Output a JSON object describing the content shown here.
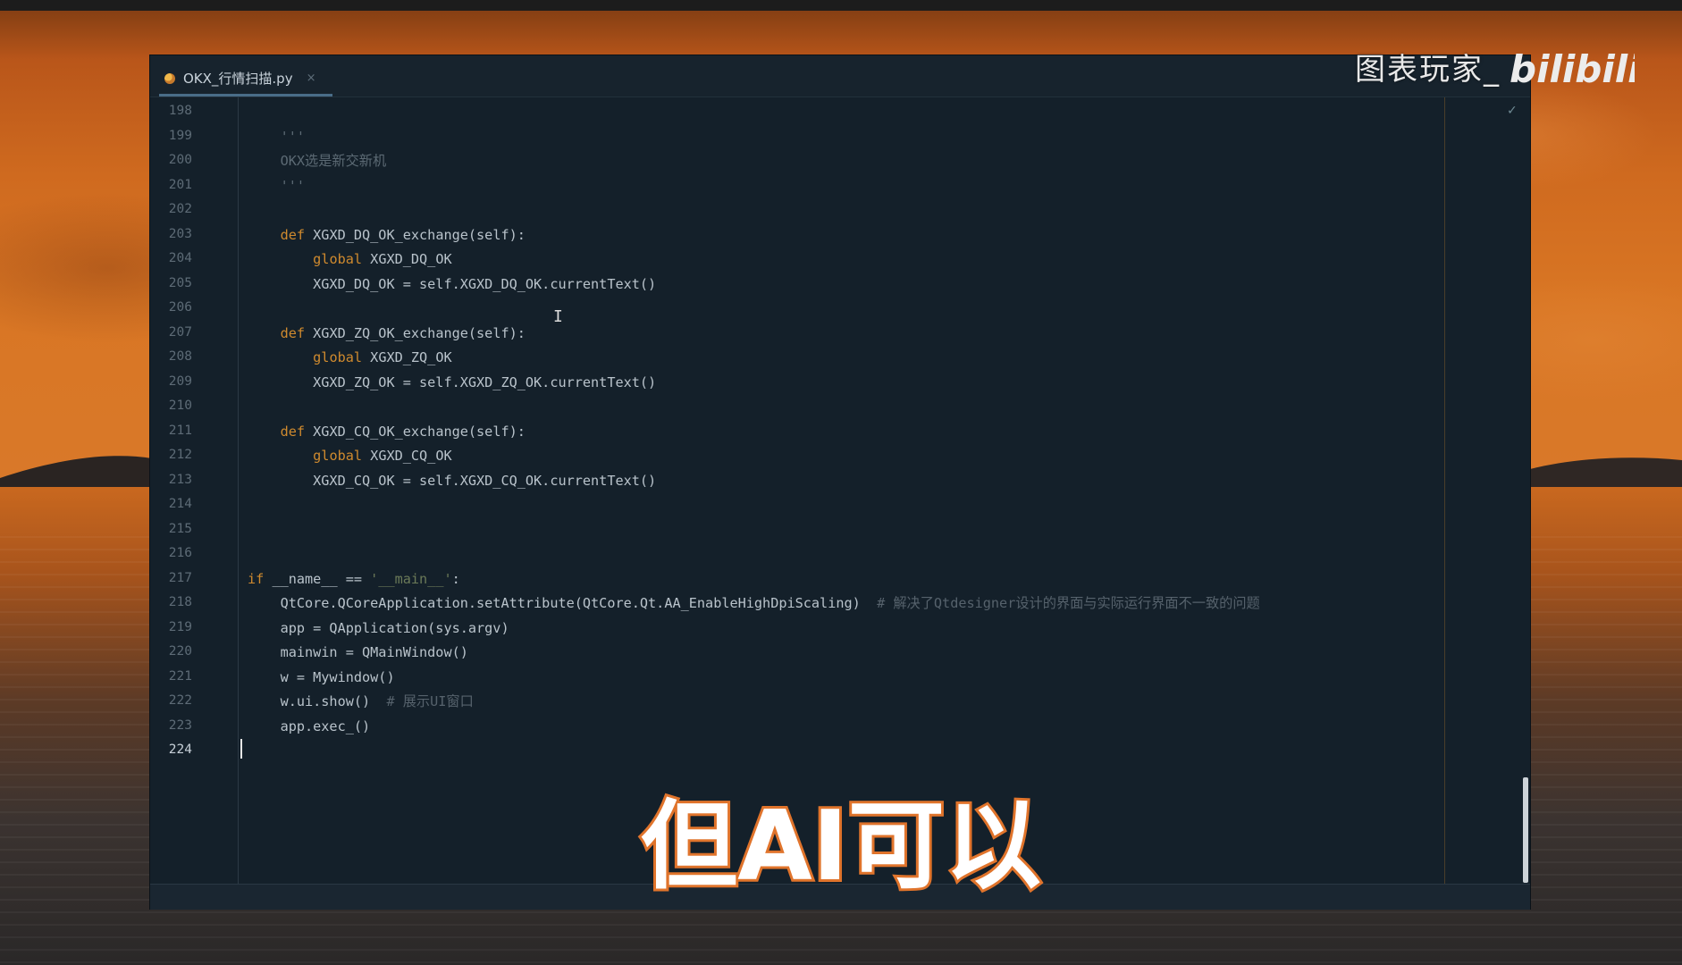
{
  "editor": {
    "tab_label": "OKX_行情扫描.py",
    "tab_close": "×",
    "current_line": "224"
  },
  "code_lines": [
    {
      "num": "198",
      "tokens": []
    },
    {
      "num": "199",
      "tokens": [
        {
          "t": "    '''",
          "c": "doc"
        }
      ]
    },
    {
      "num": "200",
      "tokens": [
        {
          "t": "    OKX选是新交新机",
          "c": "doc"
        }
      ]
    },
    {
      "num": "201",
      "tokens": [
        {
          "t": "    '''",
          "c": "doc"
        }
      ]
    },
    {
      "num": "202",
      "tokens": []
    },
    {
      "num": "203",
      "tokens": [
        {
          "t": "    ",
          "c": ""
        },
        {
          "t": "def",
          "c": "kw"
        },
        {
          "t": " XGXD_DQ_OK_exchange(self):",
          "c": ""
        }
      ]
    },
    {
      "num": "204",
      "tokens": [
        {
          "t": "        ",
          "c": ""
        },
        {
          "t": "global",
          "c": "kw"
        },
        {
          "t": " XGXD_DQ_OK",
          "c": ""
        }
      ]
    },
    {
      "num": "205",
      "tokens": [
        {
          "t": "        XGXD_DQ_OK = self.XGXD_DQ_OK.currentText()",
          "c": ""
        }
      ]
    },
    {
      "num": "206",
      "tokens": []
    },
    {
      "num": "207",
      "tokens": [
        {
          "t": "    ",
          "c": ""
        },
        {
          "t": "def",
          "c": "kw"
        },
        {
          "t": " XGXD_ZQ_OK_exchange(self):",
          "c": ""
        }
      ]
    },
    {
      "num": "208",
      "tokens": [
        {
          "t": "        ",
          "c": ""
        },
        {
          "t": "global",
          "c": "kw"
        },
        {
          "t": " XGXD_ZQ_OK",
          "c": ""
        }
      ]
    },
    {
      "num": "209",
      "tokens": [
        {
          "t": "        XGXD_ZQ_OK = self.XGXD_ZQ_OK.currentText()",
          "c": ""
        }
      ]
    },
    {
      "num": "210",
      "tokens": []
    },
    {
      "num": "211",
      "tokens": [
        {
          "t": "    ",
          "c": ""
        },
        {
          "t": "def",
          "c": "kw"
        },
        {
          "t": " XGXD_CQ_OK_exchange(self):",
          "c": ""
        }
      ]
    },
    {
      "num": "212",
      "tokens": [
        {
          "t": "        ",
          "c": ""
        },
        {
          "t": "global",
          "c": "kw"
        },
        {
          "t": " XGXD_CQ_OK",
          "c": ""
        }
      ]
    },
    {
      "num": "213",
      "tokens": [
        {
          "t": "        XGXD_CQ_OK = self.XGXD_CQ_OK.currentText()",
          "c": ""
        }
      ]
    },
    {
      "num": "214",
      "tokens": []
    },
    {
      "num": "215",
      "tokens": []
    },
    {
      "num": "216",
      "tokens": []
    },
    {
      "num": "217",
      "tokens": [
        {
          "t": "if",
          "c": "kw"
        },
        {
          "t": " __name__ == ",
          "c": ""
        },
        {
          "t": "'__main__'",
          "c": "str"
        },
        {
          "t": ":",
          "c": ""
        }
      ]
    },
    {
      "num": "218",
      "tokens": [
        {
          "t": "    QtCore.QCoreApplication.setAttribute(QtCore.Qt.AA_EnableHighDpiScaling)  ",
          "c": ""
        },
        {
          "t": "# 解决了Qtdesigner设计的界面与实际运行界面不一致的问题",
          "c": "cmt"
        }
      ]
    },
    {
      "num": "219",
      "tokens": [
        {
          "t": "    app = QApplication(sys.argv)",
          "c": ""
        }
      ]
    },
    {
      "num": "220",
      "tokens": [
        {
          "t": "    mainwin = QMainWindow()",
          "c": ""
        }
      ]
    },
    {
      "num": "221",
      "tokens": [
        {
          "t": "    w = Mywindow()",
          "c": ""
        }
      ]
    },
    {
      "num": "222",
      "tokens": [
        {
          "t": "    w.ui.show()  ",
          "c": ""
        },
        {
          "t": "# 展示UI窗口",
          "c": "cmt"
        }
      ]
    },
    {
      "num": "223",
      "tokens": [
        {
          "t": "    app.exec_()",
          "c": ""
        }
      ]
    },
    {
      "num": "224",
      "tokens": []
    }
  ],
  "overlay": {
    "watermark_text": "图表玩家_",
    "logo_text": "bilibili",
    "subtitle": "但AI可以"
  },
  "colors": {
    "editor_bg": "#14202a",
    "keyword": "#cf8a2e",
    "text": "#b9c3cb",
    "comment": "#56626c",
    "subtitle_stroke": "#e0742c"
  },
  "icons": [
    "python-file-icon",
    "close-icon",
    "check-icon",
    "text-cursor-icon",
    "bilibili-logo"
  ]
}
